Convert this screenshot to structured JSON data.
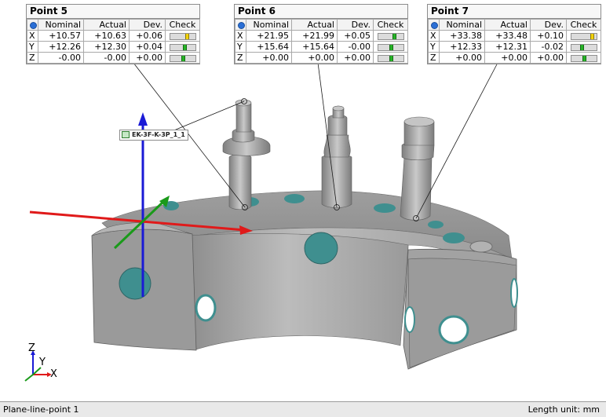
{
  "columns": {
    "nominal": "Nominal",
    "actual": "Actual",
    "dev": "Dev.",
    "check": "Check"
  },
  "point_tables": [
    {
      "title": "Point 5",
      "rows": [
        {
          "axis": "X",
          "nominal": "+10.57",
          "actual": "+10.63",
          "dev": "+0.06",
          "check_level": 0.72,
          "check_status": "warn"
        },
        {
          "axis": "Y",
          "nominal": "+12.26",
          "actual": "+12.30",
          "dev": "+0.04",
          "check_level": 0.6,
          "check_status": "ok"
        },
        {
          "axis": "Z",
          "nominal": "-0.00",
          "actual": "-0.00",
          "dev": "+0.00",
          "check_level": 0.5,
          "check_status": "ok"
        }
      ]
    },
    {
      "title": "Point 6",
      "rows": [
        {
          "axis": "X",
          "nominal": "+21.95",
          "actual": "+21.99",
          "dev": "+0.05",
          "check_level": 0.66,
          "check_status": "ok"
        },
        {
          "axis": "Y",
          "nominal": "+15.64",
          "actual": "+15.64",
          "dev": "-0.00",
          "check_level": 0.5,
          "check_status": "ok"
        },
        {
          "axis": "Z",
          "nominal": "+0.00",
          "actual": "+0.00",
          "dev": "+0.00",
          "check_level": 0.5,
          "check_status": "ok"
        }
      ]
    },
    {
      "title": "Point 7",
      "rows": [
        {
          "axis": "X",
          "nominal": "+33.38",
          "actual": "+33.48",
          "dev": "+0.10",
          "check_level": 0.9,
          "check_status": "warn"
        },
        {
          "axis": "Y",
          "nominal": "+12.33",
          "actual": "+12.31",
          "dev": "-0.02",
          "check_level": 0.42,
          "check_status": "ok"
        },
        {
          "axis": "Z",
          "nominal": "+0.00",
          "actual": "+0.00",
          "dev": "+0.00",
          "check_level": 0.5,
          "check_status": "ok"
        }
      ]
    }
  ],
  "model_label": "EK-3F-K-3P_1_1",
  "triad_labels": {
    "z": "Z",
    "y": "Y",
    "x": "X"
  },
  "status_bar": {
    "left": "Plane-line-point 1",
    "right": "Length unit: mm"
  },
  "colors": {
    "mesh": "#a5a5a5",
    "mesh_dark": "#7b7b7b",
    "hole": "#3f8f8f",
    "axis_x": "#e01a1a",
    "axis_y": "#1a9a1a",
    "axis_z": "#1a1ad6",
    "check_ok": "#27b227",
    "check_warn": "#f1d20d"
  },
  "icons": {
    "column_header": "point-marker-icon",
    "model_tag": "mesh-icon"
  }
}
